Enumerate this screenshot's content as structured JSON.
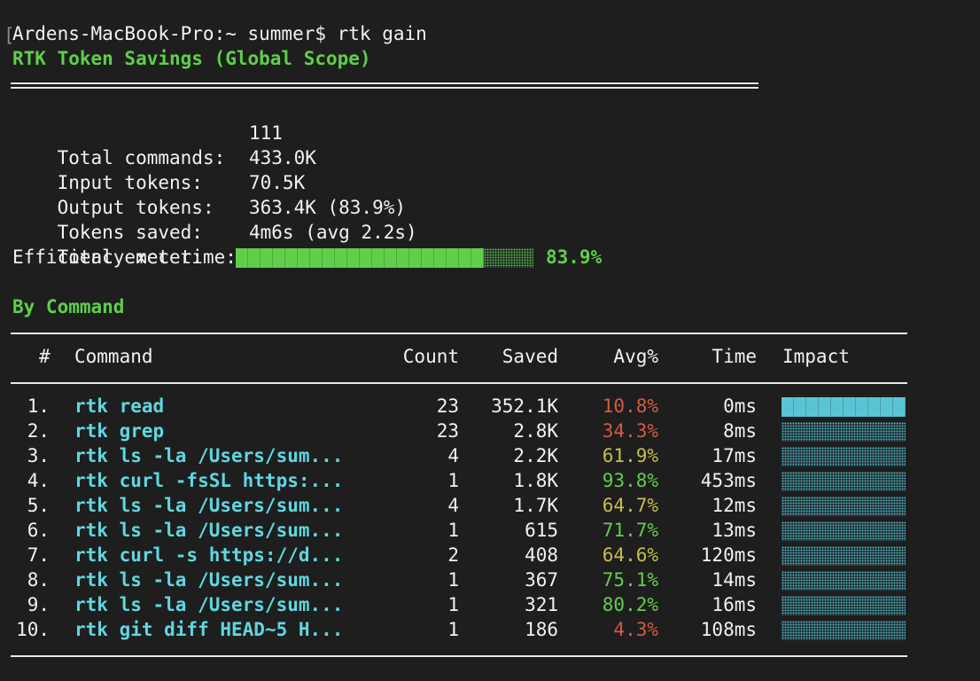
{
  "terminal": {
    "prompt_bracket": "[",
    "prompt": "Ardens-MacBook-Pro:~ summer$ rtk gain",
    "title": "RTK Token Savings (Global Scope)"
  },
  "summary": [
    {
      "label": "Total commands:",
      "value": "111"
    },
    {
      "label": "Input tokens:",
      "value": "433.0K"
    },
    {
      "label": "Output tokens:",
      "value": "70.5K"
    },
    {
      "label": "Tokens saved:",
      "value": "363.4K (83.9%)"
    },
    {
      "label": "Total exec time:",
      "value": "4m6s (avg 2.2s)"
    }
  ],
  "efficiency": {
    "label": "Efficiency meter:",
    "value_text": "83.9%",
    "fraction": 0.839
  },
  "section_title": "By Command",
  "table": {
    "headers": {
      "num": "#",
      "command": "Command",
      "count": "Count",
      "saved": "Saved",
      "avg": "Avg%",
      "time": "Time",
      "impact": "Impact"
    },
    "rows": [
      {
        "num": "1.",
        "command": "rtk read",
        "count": "23",
        "saved": "352.1K",
        "avg": "10.8%",
        "avg_color": "red",
        "time": "0ms",
        "impact": 1.0
      },
      {
        "num": "2.",
        "command": "rtk grep",
        "count": "23",
        "saved": "2.8K",
        "avg": "34.3%",
        "avg_color": "red",
        "time": "8ms",
        "impact": 0.0
      },
      {
        "num": "3.",
        "command": "rtk ls -la /Users/sum...",
        "count": "4",
        "saved": "2.2K",
        "avg": "61.9%",
        "avg_color": "yellow",
        "time": "17ms",
        "impact": 0.0
      },
      {
        "num": "4.",
        "command": "rtk curl -fsSL https:...",
        "count": "1",
        "saved": "1.8K",
        "avg": "93.8%",
        "avg_color": "green",
        "time": "453ms",
        "impact": 0.0
      },
      {
        "num": "5.",
        "command": "rtk ls -la /Users/sum...",
        "count": "4",
        "saved": "1.7K",
        "avg": "64.7%",
        "avg_color": "yellow",
        "time": "12ms",
        "impact": 0.0
      },
      {
        "num": "6.",
        "command": "rtk ls -la /Users/sum...",
        "count": "1",
        "saved": "615",
        "avg": "71.7%",
        "avg_color": "green",
        "time": "13ms",
        "impact": 0.0
      },
      {
        "num": "7.",
        "command": "rtk curl -s https://d...",
        "count": "2",
        "saved": "408",
        "avg": "64.6%",
        "avg_color": "yellow",
        "time": "120ms",
        "impact": 0.0
      },
      {
        "num": "8.",
        "command": "rtk ls -la /Users/sum...",
        "count": "1",
        "saved": "367",
        "avg": "75.1%",
        "avg_color": "green",
        "time": "14ms",
        "impact": 0.0
      },
      {
        "num": "9.",
        "command": "rtk ls -la /Users/sum...",
        "count": "1",
        "saved": "321",
        "avg": "80.2%",
        "avg_color": "green",
        "time": "16ms",
        "impact": 0.0
      },
      {
        "num": "10.",
        "command": "rtk git diff HEAD~5 H...",
        "count": "1",
        "saved": "186",
        "avg": "4.3%",
        "avg_color": "red",
        "time": "108ms",
        "impact": 0.0
      }
    ]
  },
  "colors": {
    "green": "#5fcf4a",
    "cyan": "#5fd7e0",
    "red": "#d65a41",
    "yellow": "#c6be4a",
    "impact": "#5bc4d4",
    "background": "#1e1e1e"
  }
}
